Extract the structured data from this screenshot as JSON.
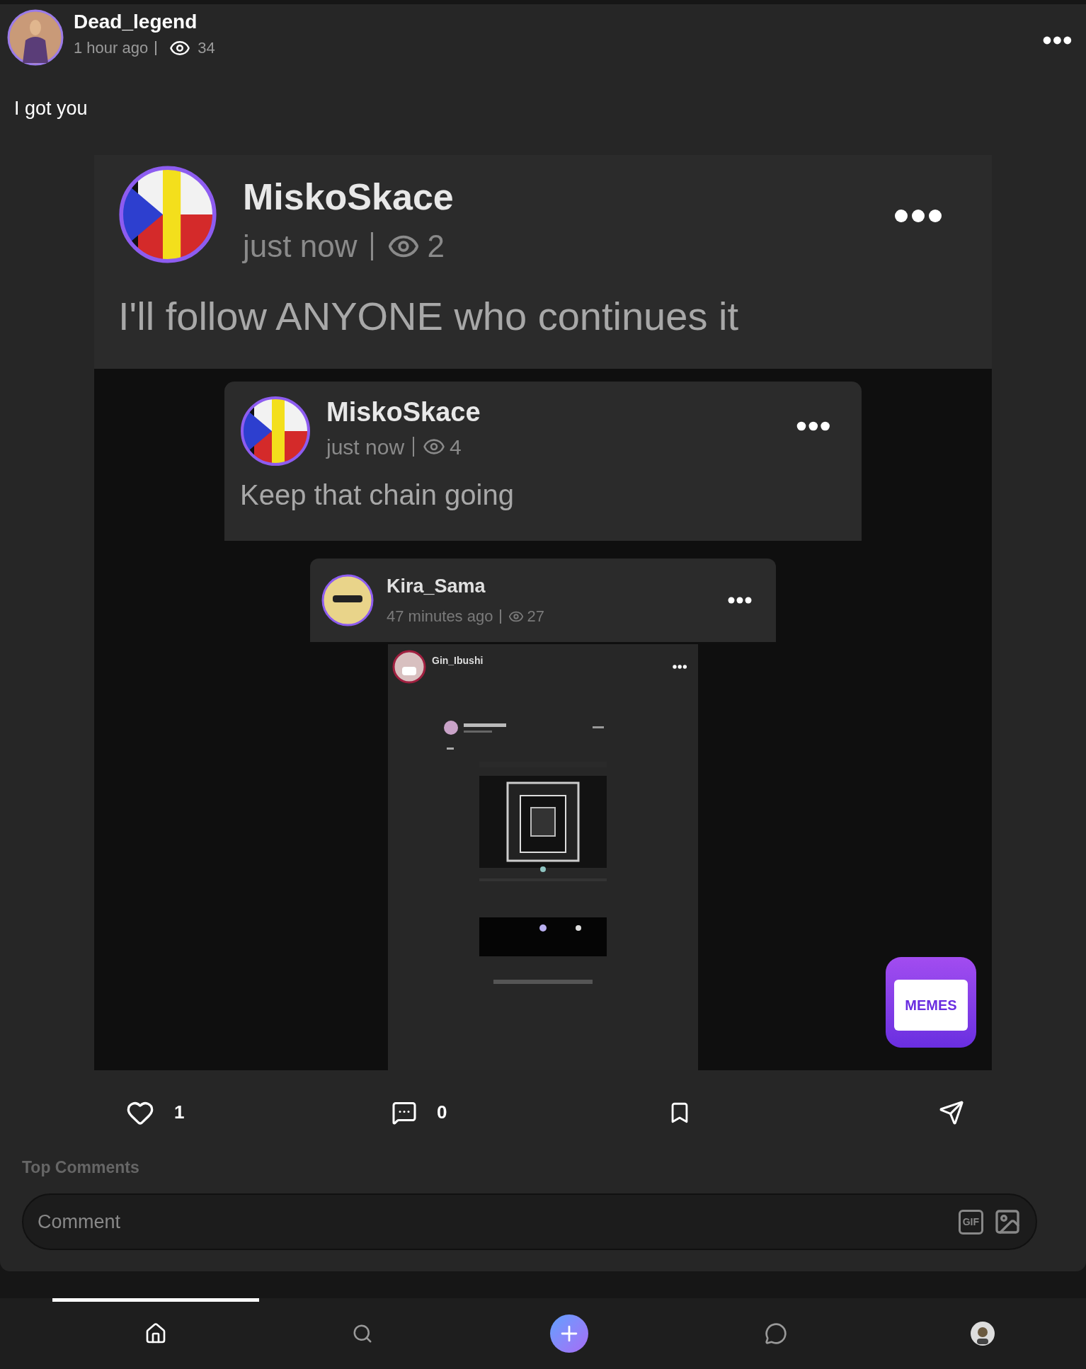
{
  "post": {
    "author": "Dead_legend",
    "time": "1 hour ago",
    "views": "34",
    "text": "I got you",
    "shared_image": {
      "author": "MiskoSkace",
      "time": "just now",
      "views": "2",
      "text": "I'll follow ANYONE who continues it",
      "nested": [
        {
          "author": "MiskoSkace",
          "time": "just now",
          "views": "4",
          "text": "Keep that chain going"
        },
        {
          "author": "Kira_Sama",
          "time": "47 minutes ago",
          "views": "27"
        },
        {
          "author": "Gin_Ibushi"
        }
      ],
      "badge": "MEMES"
    },
    "likes": "1",
    "comments": "0"
  },
  "comments_section": {
    "title": "Top Comments",
    "placeholder": "Comment",
    "gif_label": "GIF"
  },
  "bottom_nav": [
    {
      "kind": "home",
      "selected": true
    },
    {
      "kind": "search",
      "selected": false
    },
    {
      "kind": "add",
      "selected": false
    },
    {
      "kind": "chat",
      "selected": false
    },
    {
      "kind": "profile",
      "selected": false
    }
  ]
}
